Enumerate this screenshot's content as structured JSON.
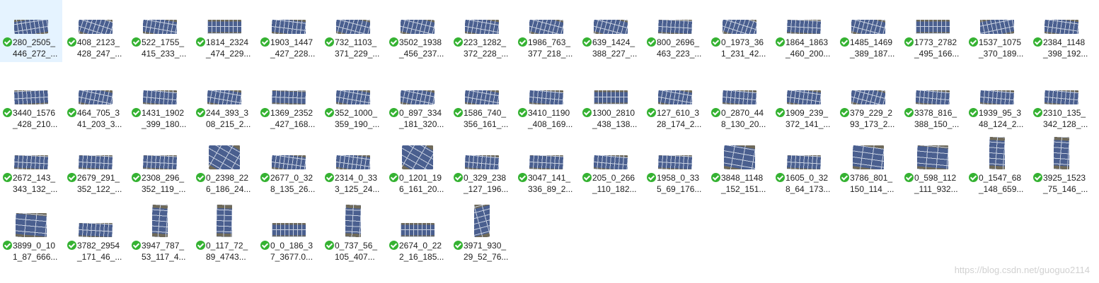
{
  "files": [
    {
      "name": "280_2505_\n446_272_...",
      "selected": true,
      "status": "synced",
      "thumb": "strip",
      "angle": -9
    },
    {
      "name": "408_2123_\n428_247_...",
      "status": "synced",
      "thumb": "strip",
      "angle": 18
    },
    {
      "name": "522_1755_\n415_233_...",
      "status": "synced",
      "thumb": "strip",
      "angle": 10
    },
    {
      "name": "1814_2324\n_474_229...",
      "status": "synced",
      "thumb": "strip",
      "angle": 0
    },
    {
      "name": "1903_1447\n_427_228...",
      "status": "synced",
      "thumb": "strip",
      "angle": 7
    },
    {
      "name": "732_1103_\n371_229_...",
      "status": "synced",
      "thumb": "strip",
      "angle": 15
    },
    {
      "name": "3502_1938\n_456_237...",
      "status": "synced",
      "thumb": "strip",
      "angle": 14
    },
    {
      "name": "223_1282_\n372_228_...",
      "status": "synced",
      "thumb": "strip",
      "angle": 10
    },
    {
      "name": "1986_763_\n377_218_...",
      "status": "synced",
      "thumb": "strip",
      "angle": 15
    },
    {
      "name": "639_1424_\n388_227_...",
      "status": "synced",
      "thumb": "strip",
      "angle": 15
    },
    {
      "name": "800_2696_\n463_223_...",
      "status": "synced",
      "thumb": "strip",
      "angle": 3
    },
    {
      "name": "0_1973_36\n1_231_42...",
      "status": "synced",
      "thumb": "strip",
      "angle": 18
    },
    {
      "name": "1864_1863\n_460_200...",
      "status": "synced",
      "thumb": "strip",
      "angle": 3
    },
    {
      "name": "1485_1469\n_389_187...",
      "status": "synced",
      "thumb": "strip",
      "angle": 15
    },
    {
      "name": "1773_2782\n_495_166...",
      "status": "synced",
      "thumb": "strip",
      "angle": 0
    },
    {
      "name": "1537_1075\n_370_189...",
      "status": "synced",
      "thumb": "strip",
      "angle": -12
    },
    {
      "name": "2384_1148\n_398_192...",
      "status": "synced",
      "thumb": "strip",
      "angle": 8
    },
    {
      "name": "3440_1576\n_428_210...",
      "status": "synced",
      "thumb": "strip",
      "angle": -3
    },
    {
      "name": "464_705_3\n41_203_3...",
      "status": "synced",
      "thumb": "strip",
      "angle": 12
    },
    {
      "name": "1431_1902\n_399_180...",
      "status": "synced",
      "thumb": "strip",
      "angle": 5
    },
    {
      "name": "244_393_3\n08_215_2...",
      "status": "synced",
      "thumb": "strip",
      "angle": 10
    },
    {
      "name": "1369_2352\n_427_168...",
      "status": "synced",
      "thumb": "strip",
      "angle": 2
    },
    {
      "name": "352_1000_\n359_190_...",
      "status": "synced",
      "thumb": "strip",
      "angle": 10
    },
    {
      "name": "0_897_334\n_181_320...",
      "status": "synced",
      "thumb": "strip",
      "angle": 12
    },
    {
      "name": "1586_740_\n356_161_...",
      "status": "synced",
      "thumb": "strip",
      "angle": 10
    },
    {
      "name": "3410_1190\n_408_169...",
      "status": "synced",
      "thumb": "strip",
      "angle": 5
    },
    {
      "name": "1300_2810\n_438_138...",
      "status": "synced",
      "thumb": "strip",
      "angle": 0
    },
    {
      "name": "127_610_3\n28_174_2...",
      "status": "synced",
      "thumb": "strip",
      "angle": 10
    },
    {
      "name": "0_2870_44\n8_130_20...",
      "status": "synced",
      "thumb": "strip",
      "angle": 5
    },
    {
      "name": "1909_239_\n372_141_...",
      "status": "synced",
      "thumb": "strip",
      "angle": 8
    },
    {
      "name": "379_229_2\n93_173_2...",
      "status": "synced",
      "thumb": "strip",
      "angle": 15
    },
    {
      "name": "3378_816_\n388_150_...",
      "status": "synced",
      "thumb": "strip",
      "angle": 5
    },
    {
      "name": "1939_95_3\n48_124_2...",
      "status": "synced",
      "thumb": "strip",
      "angle": 5
    },
    {
      "name": "2310_135_\n342_128_...",
      "status": "synced",
      "thumb": "strip",
      "angle": 5
    },
    {
      "name": "2672_143_\n343_132_...",
      "status": "synced",
      "thumb": "strip",
      "angle": 3
    },
    {
      "name": "2679_291_\n352_122_...",
      "status": "synced",
      "thumb": "strip",
      "angle": 3
    },
    {
      "name": "2308_296_\n352_119_...",
      "status": "synced",
      "thumb": "strip",
      "angle": 3
    },
    {
      "name": "0_2398_22\n6_186_24...",
      "status": "synced",
      "thumb": "panel",
      "angle": 30
    },
    {
      "name": "2677_0_32\n8_135_26...",
      "status": "synced",
      "thumb": "strip",
      "angle": 8
    },
    {
      "name": "2314_0_33\n3_125_24...",
      "status": "synced",
      "thumb": "strip",
      "angle": 8
    },
    {
      "name": "0_1201_19\n6_161_20...",
      "status": "synced",
      "thumb": "panel",
      "angle": 30
    },
    {
      "name": "0_329_238\n_127_196...",
      "status": "synced",
      "thumb": "strip",
      "angle": 5
    },
    {
      "name": "3047_141_\n336_89_2...",
      "status": "synced",
      "thumb": "strip",
      "angle": 3
    },
    {
      "name": "205_0_266\n_110_182...",
      "status": "synced",
      "thumb": "strip",
      "angle": 5
    },
    {
      "name": "1958_0_33\n5_69_176...",
      "status": "synced",
      "thumb": "strip",
      "angle": 3
    },
    {
      "name": "3848_1148\n_152_151...",
      "status": "synced",
      "thumb": "panel",
      "angle": 10
    },
    {
      "name": "1605_0_32\n8_64_173...",
      "status": "synced",
      "thumb": "strip",
      "angle": 3
    },
    {
      "name": "3786_801_\n150_114_...",
      "status": "synced",
      "thumb": "panel",
      "angle": 8
    },
    {
      "name": "0_598_112\n_111_932...",
      "status": "synced",
      "thumb": "panel",
      "angle": 5
    },
    {
      "name": "0_1547_68\n_148_659...",
      "status": "synced",
      "thumb": "tall",
      "angle": 4
    },
    {
      "name": "3925_1523\n_75_146_...",
      "status": "synced",
      "thumb": "tall",
      "angle": 4
    },
    {
      "name": "3899_0_10\n1_87_666...",
      "status": "synced",
      "thumb": "panel",
      "angle": 5
    },
    {
      "name": "3782_2954\n_171_46_...",
      "status": "synced",
      "thumb": "strip",
      "angle": 3
    },
    {
      "name": "3947_787_\n53_117_4...",
      "status": "synced",
      "thumb": "tall",
      "angle": 4
    },
    {
      "name": "0_117_72_\n89_4743...",
      "status": "synced",
      "thumb": "tall",
      "angle": 2
    },
    {
      "name": "0_0_186_3\n7_3677.0...",
      "status": "synced",
      "thumb": "strip",
      "angle": 0
    },
    {
      "name": "0_737_56_\n105_407...",
      "status": "synced",
      "thumb": "tall",
      "angle": 3
    },
    {
      "name": "2674_0_22\n2_16_185...",
      "status": "synced",
      "thumb": "strip",
      "angle": 0
    },
    {
      "name": "3971_930_\n29_52_76...",
      "status": "synced",
      "thumb": "tall",
      "angle": -15
    }
  ],
  "watermark": "https://blog.csdn.net/guoguo2114",
  "colors": {
    "panel_blue": "#4a5f8f",
    "panel_grid": "#c8d0e0",
    "background_terrain": "#6f6a5a",
    "selected_tile": "#e5f3ff",
    "status_green": "#35b232",
    "watermark_text": "#d1d1d1"
  }
}
